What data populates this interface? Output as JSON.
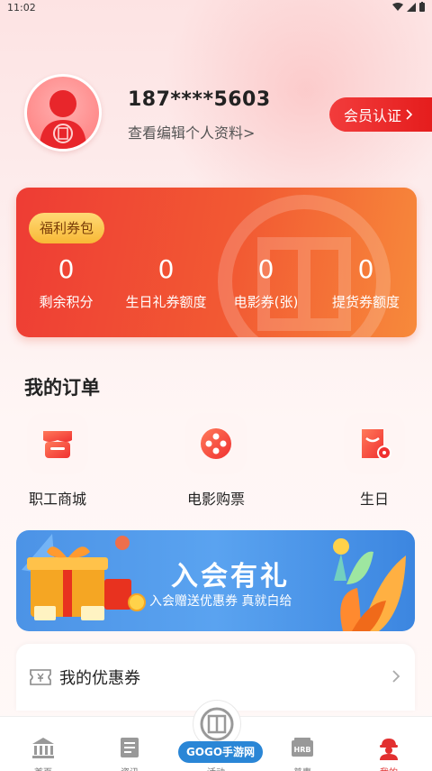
{
  "status": {
    "time": "11:02"
  },
  "profile": {
    "phone": "187****5603",
    "edit_link": "查看编辑个人资料>",
    "member_button": "会员认证"
  },
  "benefits": {
    "badge": "福利券包",
    "stats": [
      {
        "value": "0",
        "label": "剩余积分"
      },
      {
        "value": "0",
        "label": "生日礼券额度"
      },
      {
        "value": "0",
        "label": "电影券(张)"
      },
      {
        "value": "0",
        "label": "提货券额度"
      }
    ]
  },
  "orders": {
    "title": "我的订单",
    "items": [
      {
        "label": "职工商城",
        "icon": "shop-icon"
      },
      {
        "label": "电影购票",
        "icon": "film-reel-icon"
      },
      {
        "label": "生日",
        "icon": "birthday-icon"
      }
    ]
  },
  "banner": {
    "title": "入会有礼",
    "subtitle": "入会赠送优惠券 真就白给"
  },
  "coupons": {
    "label": "我的优惠券"
  },
  "tabbar": {
    "items": [
      {
        "label": "首页",
        "icon": "building-icon"
      },
      {
        "label": "资讯",
        "icon": "news-icon"
      },
      {
        "label": "活动",
        "icon": "union-logo-icon"
      },
      {
        "label": "普惠",
        "icon": "hrb-icon"
      },
      {
        "label": "我的",
        "icon": "worker-icon"
      }
    ]
  },
  "watermark": "GOGO手游网",
  "colors": {
    "accent": "#e51d1d",
    "card_start": "#ee3c34",
    "card_end": "#f78a3b",
    "banner": "#4c93e6",
    "badge": "#f8b936"
  }
}
